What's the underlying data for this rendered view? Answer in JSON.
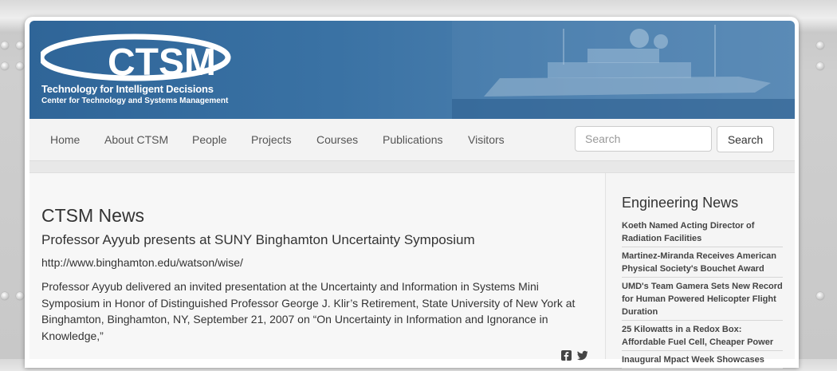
{
  "brand": {
    "logo_text": "CTSM",
    "tagline": "Technology for Intelligent Decisions",
    "subtagline": "Center for Technology and Systems Management"
  },
  "nav": {
    "items": [
      "Home",
      "About CTSM",
      "People",
      "Projects",
      "Courses",
      "Publications",
      "Visitors"
    ],
    "search_placeholder": "Search",
    "search_button": "Search"
  },
  "main": {
    "page_title": "CTSM News",
    "article": {
      "title": "Professor Ayyub presents at SUNY Binghamton Uncertainty Symposium",
      "url": "http://www.binghamton.edu/watson/wise/",
      "body": "Professor Ayyub delivered an invited presentation at the Uncertainty and Information in Systems Mini Symposium in Honor of Distinguished Professor George J. Klir’s Retirement, State University of New York at Binghamton, Binghamton, NY, September 21, 2007 on “On Uncertainty in Information and Ignorance in Knowledge,”"
    },
    "share_icons": [
      "facebook-icon",
      "twitter-icon"
    ]
  },
  "sidebar": {
    "title": "Engineering News",
    "items": [
      "Koeth Named Acting Director of Radiation Facilities",
      "Martinez-Miranda Receives American Physical Society's Bouchet Award",
      "UMD's Team Gamera Sets New Record for Human Powered Helicopter Flight Duration",
      "25 Kilowatts in a Redox Box: Affordable Fuel Cell, Cheaper Power",
      "Inaugural Mpact Week Showcases"
    ]
  },
  "colors": {
    "banner": "#3a72a4",
    "text": "#333333",
    "nav_text": "#555555"
  }
}
